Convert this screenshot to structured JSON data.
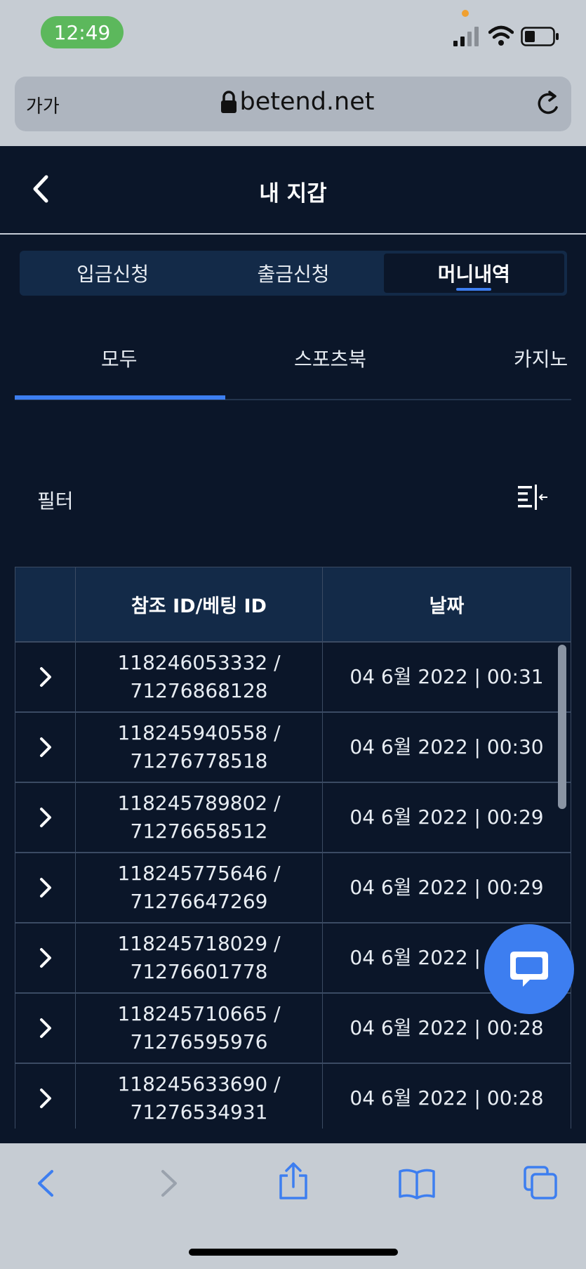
{
  "status_bar": {
    "time": "12:49"
  },
  "browser": {
    "text_size_label": "가가",
    "domain": "betend.net"
  },
  "header": {
    "title": "내 지갑"
  },
  "segment_tabs": [
    {
      "label": "입금신청",
      "active": false
    },
    {
      "label": "출금신청",
      "active": false
    },
    {
      "label": "머니내역",
      "active": true
    }
  ],
  "sub_tabs": [
    {
      "label": "모두",
      "active": true
    },
    {
      "label": "스포츠북",
      "active": false
    },
    {
      "label": "카지노",
      "active": false
    }
  ],
  "filter": {
    "label": "필터"
  },
  "table": {
    "headers": [
      "참조 ID/베팅 ID",
      "날짜"
    ],
    "rows": [
      {
        "ref_id": "118246053332 /",
        "bet_id": "71276868128",
        "date": "04 6월 2022 | 00:31"
      },
      {
        "ref_id": "118245940558 /",
        "bet_id": "71276778518",
        "date": "04 6월 2022 | 00:30"
      },
      {
        "ref_id": "118245789802 /",
        "bet_id": "71276658512",
        "date": "04 6월 2022 | 00:29"
      },
      {
        "ref_id": "118245775646 /",
        "bet_id": "71276647269",
        "date": "04 6월 2022 | 00:29"
      },
      {
        "ref_id": "118245718029 /",
        "bet_id": "71276601778",
        "date": "04 6월 2022 | 00:29"
      },
      {
        "ref_id": "118245710665 /",
        "bet_id": "71276595976",
        "date": "04 6월 2022 | 00:28"
      },
      {
        "ref_id": "118245633690 /",
        "bet_id": "71276534931",
        "date": "04 6월 2022 | 00:28"
      }
    ]
  },
  "colors": {
    "background": "#0b1629",
    "accent": "#3d7ef0",
    "header_bg": "#132a48",
    "status_green": "#5cb85c"
  }
}
